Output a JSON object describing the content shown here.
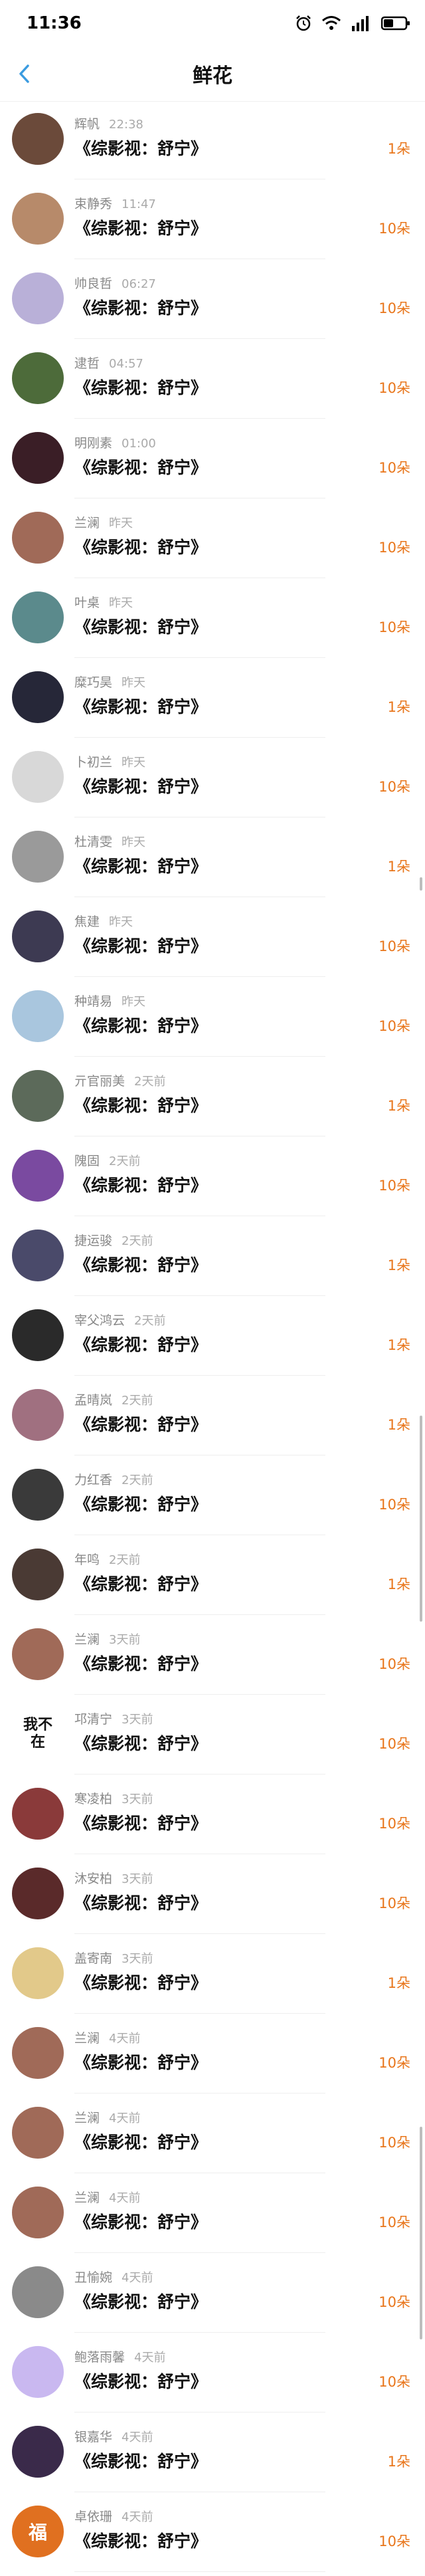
{
  "status_bar": {
    "time": "11:36"
  },
  "nav": {
    "title": "鲜花"
  },
  "rows": [
    {
      "name": "辉帆",
      "time": "22:38",
      "title": "《综影视：舒宁》",
      "amount": "1朵",
      "avatar_color": "#6b4a3a"
    },
    {
      "name": "束静秀",
      "time": "11:47",
      "title": "《综影视：舒宁》",
      "amount": "10朵",
      "avatar_color": "#b78a6a"
    },
    {
      "name": "帅良哲",
      "time": "06:27",
      "title": "《综影视：舒宁》",
      "amount": "10朵",
      "avatar_color": "#b9b0d8"
    },
    {
      "name": "逮哲",
      "time": "04:57",
      "title": "《综影视：舒宁》",
      "amount": "10朵",
      "avatar_color": "#4d6b3a"
    },
    {
      "name": "明刚素",
      "time": "01:00",
      "title": "《综影视：舒宁》",
      "amount": "10朵",
      "avatar_color": "#3a1e26"
    },
    {
      "name": "兰澜",
      "time": "昨天",
      "title": "《综影视：舒宁》",
      "amount": "10朵",
      "avatar_color": "#a06a58"
    },
    {
      "name": "叶桌",
      "time": "昨天",
      "title": "《综影视：舒宁》",
      "amount": "10朵",
      "avatar_color": "#5b8a8c"
    },
    {
      "name": "糜巧昊",
      "time": "昨天",
      "title": "《综影视：舒宁》",
      "amount": "1朵",
      "avatar_color": "#262738"
    },
    {
      "name": "卜初兰",
      "time": "昨天",
      "title": "《综影视：舒宁》",
      "amount": "10朵",
      "avatar_color": "#d8d8d8"
    },
    {
      "name": "杜清雯",
      "time": "昨天",
      "title": "《综影视：舒宁》",
      "amount": "1朵",
      "avatar_color": "#9a9a9a"
    },
    {
      "name": "焦建",
      "time": "昨天",
      "title": "《综影视：舒宁》",
      "amount": "10朵",
      "avatar_color": "#3d3a52"
    },
    {
      "name": "种靖易",
      "time": "昨天",
      "title": "《综影视：舒宁》",
      "amount": "10朵",
      "avatar_color": "#a9c6de"
    },
    {
      "name": "亓官丽美",
      "time": "2天前",
      "title": "《综影视：舒宁》",
      "amount": "1朵",
      "avatar_color": "#5c6a5a"
    },
    {
      "name": "隗固",
      "time": "2天前",
      "title": "《综影视：舒宁》",
      "amount": "10朵",
      "avatar_color": "#7a4aa0"
    },
    {
      "name": "捷运骏",
      "time": "2天前",
      "title": "《综影视：舒宁》",
      "amount": "1朵",
      "avatar_color": "#4a4a6a"
    },
    {
      "name": "宰父鸿云",
      "time": "2天前",
      "title": "《综影视：舒宁》",
      "amount": "1朵",
      "avatar_color": "#2a2a2a"
    },
    {
      "name": "孟晴岚",
      "time": "2天前",
      "title": "《综影视：舒宁》",
      "amount": "1朵",
      "avatar_color": "#a07080"
    },
    {
      "name": "力红香",
      "time": "2天前",
      "title": "《综影视：舒宁》",
      "amount": "10朵",
      "avatar_color": "#3a3a3a"
    },
    {
      "name": "年鸣",
      "time": "2天前",
      "title": "《综影视：舒宁》",
      "amount": "1朵",
      "avatar_color": "#4a3a34"
    },
    {
      "name": "兰澜",
      "time": "3天前",
      "title": "《综影视：舒宁》",
      "amount": "10朵",
      "avatar_color": "#a06a58"
    },
    {
      "name": "邛清宁",
      "time": "3天前",
      "title": "《综影视：舒宁》",
      "amount": "10朵",
      "avatar_color": "#ffffff",
      "avatar_text": "我不在"
    },
    {
      "name": "寒凌柏",
      "time": "3天前",
      "title": "《综影视：舒宁》",
      "amount": "10朵",
      "avatar_color": "#8a3a3a"
    },
    {
      "name": "沐安柏",
      "time": "3天前",
      "title": "《综影视：舒宁》",
      "amount": "10朵",
      "avatar_color": "#5a2a2a"
    },
    {
      "name": "盖寄南",
      "time": "3天前",
      "title": "《综影视：舒宁》",
      "amount": "1朵",
      "avatar_color": "#e2c98a"
    },
    {
      "name": "兰澜",
      "time": "4天前",
      "title": "《综影视：舒宁》",
      "amount": "10朵",
      "avatar_color": "#a06a58"
    },
    {
      "name": "兰澜",
      "time": "4天前",
      "title": "《综影视：舒宁》",
      "amount": "10朵",
      "avatar_color": "#a06a58"
    },
    {
      "name": "兰澜",
      "time": "4天前",
      "title": "《综影视：舒宁》",
      "amount": "10朵",
      "avatar_color": "#a06a58"
    },
    {
      "name": "丑愉婉",
      "time": "4天前",
      "title": "《综影视：舒宁》",
      "amount": "10朵",
      "avatar_color": "#8a8a8a"
    },
    {
      "name": "鲍落雨馨",
      "time": "4天前",
      "title": "《综影视：舒宁》",
      "amount": "10朵",
      "avatar_color": "#c9b8f0"
    },
    {
      "name": "银嘉华",
      "time": "4天前",
      "title": "《综影视：舒宁》",
      "amount": "1朵",
      "avatar_color": "#3a2a4a"
    },
    {
      "name": "卓依珊",
      "time": "4天前",
      "title": "《综影视：舒宁》",
      "amount": "10朵",
      "avatar_color": "#e07020",
      "avatar_text": "福"
    }
  ]
}
